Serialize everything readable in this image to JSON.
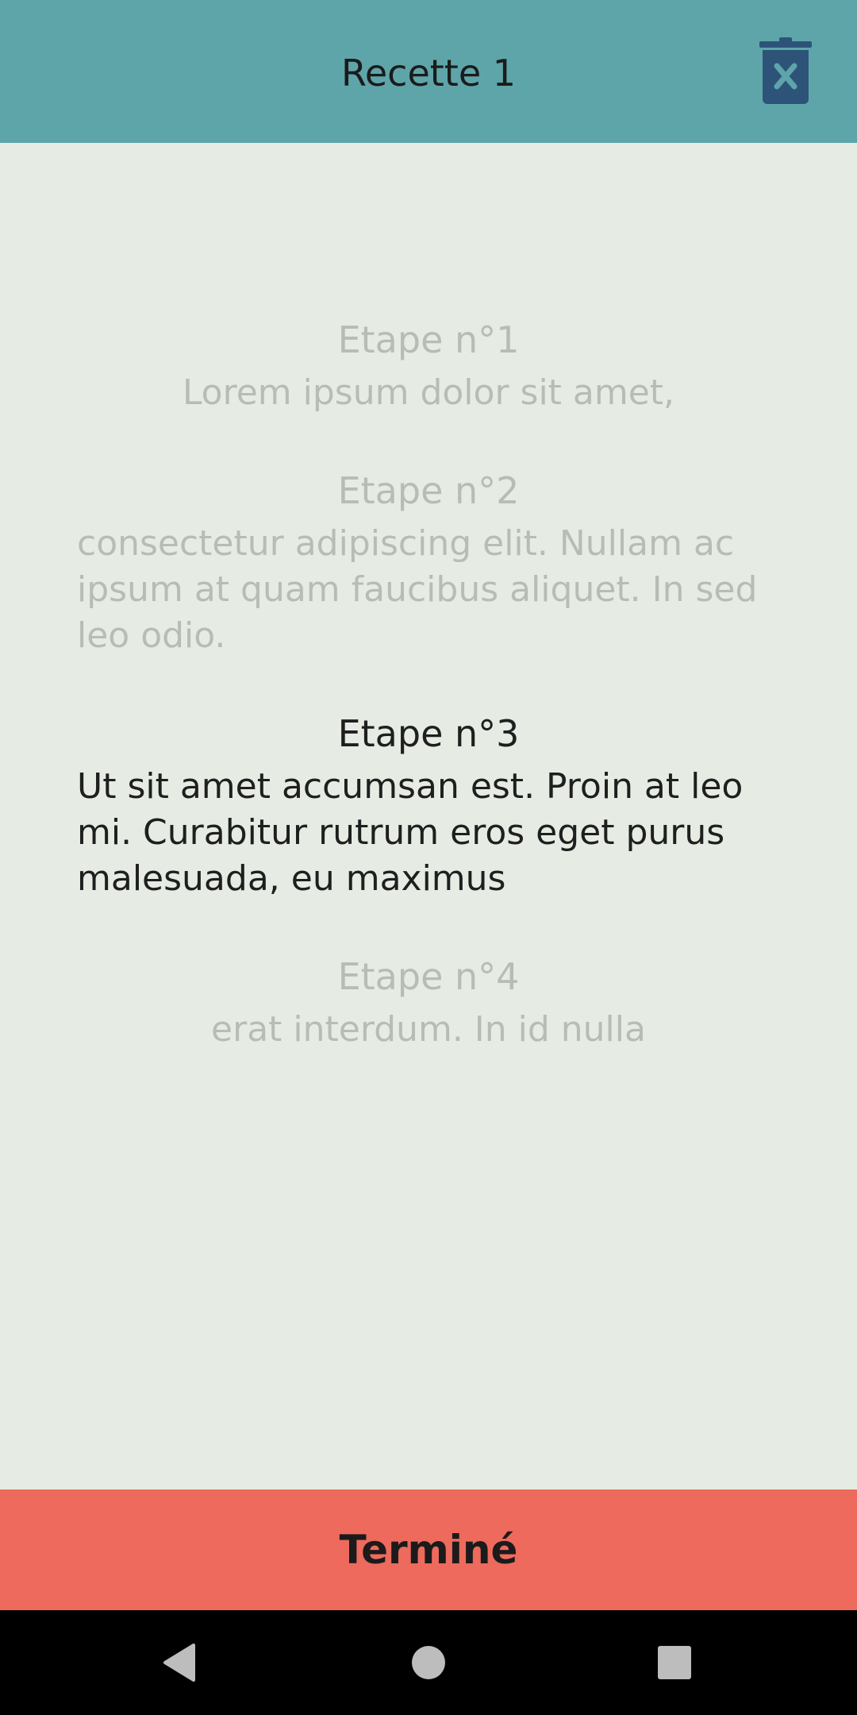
{
  "header": {
    "title": "Recette 1",
    "delete_icon": "trash-x-icon"
  },
  "steps": [
    {
      "title": "Etape n°1",
      "text": "Lorem ipsum dolor sit amet,",
      "state": "inactive"
    },
    {
      "title": "Etape n°2",
      "text": "consectetur adipiscing elit. Nullam ac ipsum at quam faucibus aliquet. In sed leo odio.",
      "state": "inactive"
    },
    {
      "title": "Etape n°3",
      "text": "Ut sit amet accumsan est. Proin at leo mi. Curabitur rutrum eros eget purus malesuada, eu maximus",
      "state": "current"
    },
    {
      "title": "Etape n°4",
      "text": "erat interdum. In id nulla",
      "state": "inactive"
    }
  ],
  "footer": {
    "done_label": "Terminé"
  },
  "colors": {
    "app_bar": "#5EA5AA",
    "background": "#E6ECE3",
    "done_button": "#EE6A5C",
    "icon": "#2D5478",
    "inactive_text": "#B8BCB6"
  },
  "system_nav": {
    "icons": [
      "back-icon",
      "home-icon",
      "recents-icon"
    ]
  }
}
